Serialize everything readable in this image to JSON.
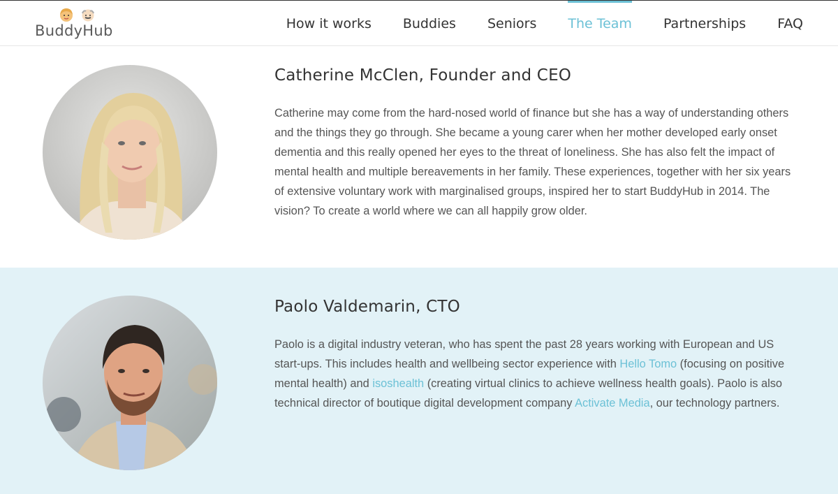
{
  "header": {
    "logo_text": "BuddyHub",
    "nav": [
      {
        "label": "How it works"
      },
      {
        "label": "Buddies"
      },
      {
        "label": "Seniors"
      },
      {
        "label": "The Team",
        "active": true
      },
      {
        "label": "Partnerships"
      },
      {
        "label": "FAQ"
      }
    ]
  },
  "team": [
    {
      "name": "Catherine McClen, Founder and CEO",
      "bio": "Catherine may come from the hard-nosed world of finance but she has a way of understanding others and the things they go through. She became a young carer when her mother developed early onset dementia and this really opened her eyes to the threat of loneliness. She has also felt the impact of mental health and multiple bereavements in her family. These experiences, together with her six years of extensive voluntary work with marginalised groups, inspired her to start BuddyHub in 2014. The vision? To create a world where we can all happily grow older."
    },
    {
      "name": "Paolo Valdemarin, CTO",
      "bio_part1": "Paolo is a digital industry veteran, who has spent the past 28 years working with European and US start-ups. This includes health and wellbeing sector experience with ",
      "link1": "Hello Tomo",
      "bio_part2": " (focusing on positive mental health) and ",
      "link2": "isoshealth",
      "bio_part3": " (creating virtual clinics to achieve wellness health goals). Paolo is also technical director of boutique digital development company ",
      "link3": "Activate Media",
      "bio_part4": ", our technology partners."
    }
  ],
  "colors": {
    "accent": "#6cc1d6",
    "alt_section_bg": "#e2f2f7"
  }
}
